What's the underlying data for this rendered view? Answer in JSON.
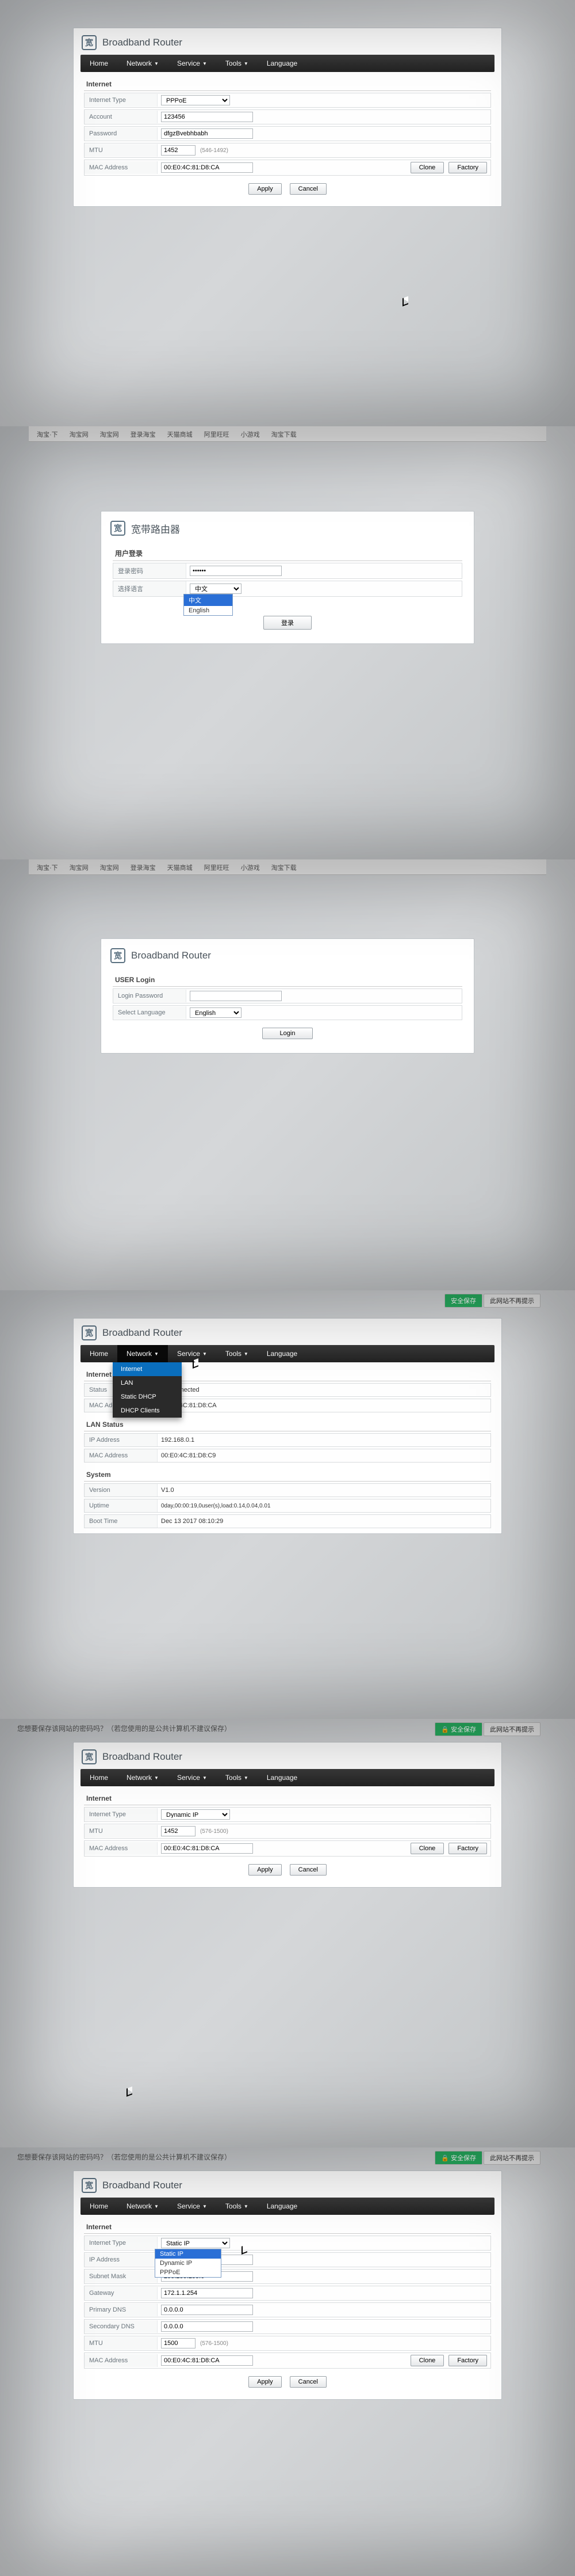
{
  "brand_logo_char": "宽",
  "brand_title_en": "Broadband Router",
  "brand_title_cn": "宽带路由器",
  "nav": {
    "home": "Home",
    "network": "Network",
    "service": "Service",
    "tools": "Tools",
    "language": "Language"
  },
  "network_menu": {
    "internet": "Internet",
    "lan": "LAN",
    "static_dhcp": "Static DHCP",
    "dhcp_clients": "DHCP Clients"
  },
  "shot1": {
    "section": "Internet",
    "rows": {
      "internet_type": "Internet Type",
      "account": "Account",
      "password": "Password",
      "mtu": "MTU",
      "mac": "MAC Address"
    },
    "values": {
      "internet_type": "PPPoE",
      "account": "123456",
      "password": "dfgzBvebhbabh",
      "mtu": "1452",
      "mtu_hint": "(546-1492)",
      "mac": "00:E0:4C:81:D8:CA"
    },
    "buttons": {
      "clone": "Clone",
      "factory": "Factory",
      "apply": "Apply",
      "cancel": "Cancel"
    }
  },
  "shot2": {
    "tabs": [
      "淘宝·下",
      "淘宝网",
      "淘宝网",
      "登录海宝",
      "天猫商城",
      "阿里旺旺",
      "小游戏",
      "淘宝下载"
    ],
    "section_user": "用户登录",
    "rows": {
      "login_pwd": "登录密码",
      "select_lang": "选择语言"
    },
    "login_btn": "登录",
    "lang_current": "中文",
    "lang_options": [
      "中文",
      "English"
    ]
  },
  "shot3": {
    "tabs": [
      "淘宝·下",
      "淘宝网",
      "淘宝网",
      "登录海宝",
      "天猫商城",
      "阿里旺旺",
      "小游戏",
      "淘宝下载"
    ],
    "section": "USER Login",
    "rows": {
      "login_pwd": "Login Password",
      "select_lang": "Select Language"
    },
    "lang_value": "English",
    "login_btn": "Login"
  },
  "shot4": {
    "sections": {
      "internet_status": "Internet Status",
      "lan_status": "LAN Status",
      "system": "System"
    },
    "rows": {
      "status": "Status",
      "mac": "MAC Address",
      "ip": "IP Address",
      "version": "Version",
      "uptime": "Uptime",
      "boot_time": "Boot Time"
    },
    "values": {
      "status": "Disconnected",
      "mac_wan": "00:E0:4C:81:D8:CA",
      "ip_lan": "192.168.0.1",
      "mac_lan": "00:E0:4C:81:D8:C9",
      "version": "V1.0",
      "uptime": "0day,00:00:19,0user(s),load:0.14,0.04,0.01",
      "boot_time": "Dec 13 2017 08:10:29"
    }
  },
  "shot5": {
    "prompt": "您想要保存该网站的密码吗？（若您使用的是公共计算机不建议保存）",
    "save_btn": "安全保存",
    "no_prompt": "此网站不再提示",
    "section": "Internet",
    "rows": {
      "internet_type": "Internet Type",
      "mtu": "MTU",
      "mac": "MAC Address"
    },
    "values": {
      "internet_type": "Dynamic IP",
      "mtu": "1452",
      "mtu_hint": "(576-1500)",
      "mac": "00:E0:4C:81:D8:CA"
    },
    "buttons": {
      "clone": "Clone",
      "factory": "Factory",
      "apply": "Apply",
      "cancel": "Cancel"
    }
  },
  "shot6": {
    "prompt": "您想要保存该网站的密码吗？（若您使用的是公共计算机不建议保存）",
    "save_btn": "安全保存",
    "no_prompt": "此网站不再提示",
    "section": "Internet",
    "rows": {
      "internet_type": "Internet Type",
      "ip": "IP Address",
      "mask": "Subnet Mask",
      "gw": "Gateway",
      "dns1": "Primary DNS",
      "dns2": "Secondary DNS",
      "mtu": "MTU",
      "mac": "MAC Address"
    },
    "values": {
      "internet_type": "Static IP",
      "options": [
        "Static IP",
        "Dynamic IP",
        "PPPoE"
      ],
      "ip": "",
      "mask": "255.255.255.0",
      "gw": "172.1.1.254",
      "dns1": "0.0.0.0",
      "dns2": "0.0.0.0",
      "mtu": "1500",
      "mtu_hint": "(576-1500)",
      "mac": "00:E0:4C:81:D8:CA"
    },
    "buttons": {
      "clone": "Clone",
      "factory": "Factory",
      "apply": "Apply",
      "cancel": "Cancel"
    }
  }
}
